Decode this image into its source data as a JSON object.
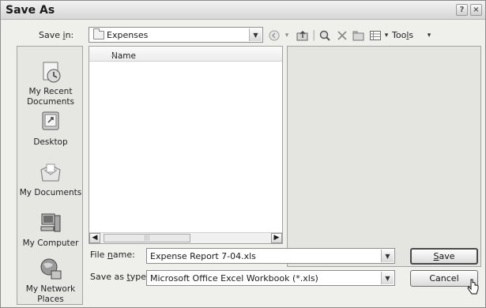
{
  "window": {
    "title": "Save As",
    "help_glyph": "?",
    "close_glyph": "×"
  },
  "toolbar": {
    "save_in_label_pre": "Save ",
    "save_in_label_ul": "i",
    "save_in_label_post": "n:",
    "location_value": "Expenses",
    "tools_label_pre": "Too",
    "tools_label_ul": "l",
    "tools_label_post": "s",
    "icons": [
      "back-icon",
      "up-folder-icon",
      "search-web-icon",
      "delete-icon",
      "new-folder-icon",
      "views-icon"
    ]
  },
  "places": [
    {
      "label_line1": "My Recent",
      "label_line2": "Documents",
      "icon": "recent-documents-icon"
    },
    {
      "label_line1": "Desktop",
      "label_line2": "",
      "icon": "desktop-icon"
    },
    {
      "label_line1": "My Documents",
      "label_line2": "",
      "icon": "my-documents-icon"
    },
    {
      "label_line1": "My Computer",
      "label_line2": "",
      "icon": "my-computer-icon"
    },
    {
      "label_line1": "My Network",
      "label_line2": "Places",
      "icon": "my-network-places-icon"
    }
  ],
  "file_list": {
    "column_name": "Name",
    "sort_glyph": "▲"
  },
  "form": {
    "file_name_label_pre": "File ",
    "file_name_label_ul": "n",
    "file_name_label_post": "ame:",
    "file_name_value": "Expense Report 7-04.xls",
    "save_type_label_pre": "Save as ",
    "save_type_label_ul": "t",
    "save_type_label_post": "ype:",
    "save_type_value": "Microsoft Office Excel Workbook (*.xls)"
  },
  "buttons": {
    "save_ul": "S",
    "save_post": "ave",
    "cancel": "Cancel"
  }
}
